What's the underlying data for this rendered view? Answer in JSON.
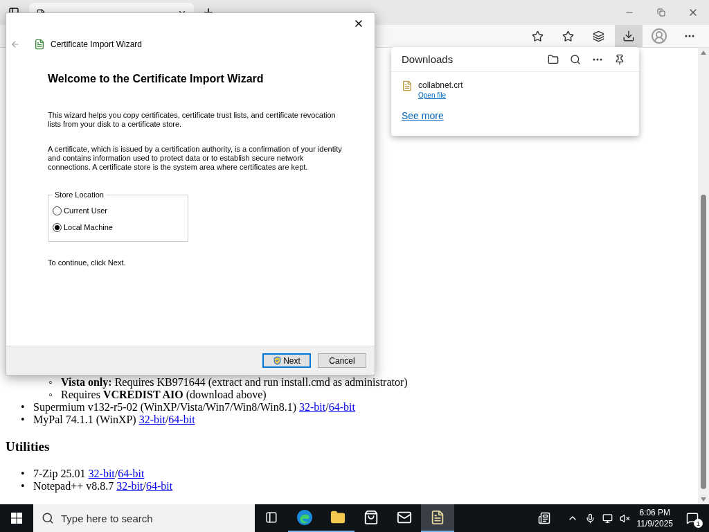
{
  "browser": {
    "tab": {
      "kind": "page"
    },
    "toolbar_buttons": [
      {
        "kind": "add-favorite",
        "selected": false
      },
      {
        "kind": "favorites",
        "selected": false
      },
      {
        "kind": "collections",
        "selected": false
      },
      {
        "kind": "downloads",
        "selected": true
      },
      {
        "kind": "profile",
        "selected": false
      },
      {
        "kind": "more",
        "selected": false
      }
    ]
  },
  "downloads_panel": {
    "title": "Downloads",
    "items": [
      {
        "file": "collabnet.crt",
        "action": "Open file"
      }
    ],
    "see_more": "See more"
  },
  "page": {
    "sections": [
      {
        "kind": "list",
        "items": [
          {
            "children": [
              {
                "marker": "◦",
                "text": "**Vista only:** Requires KB971644 (extract and run install.cmd as administrator)"
              },
              {
                "marker": "◦",
                "text": "Requires **VCREDIST AIO** (download above)"
              }
            ]
          },
          {
            "marker": "•",
            "text": "Supermium v132-r5-02 (WinXP/Vista/Win7/Win8/Win8.1)",
            "links": [
              "32-bit",
              "64-bit"
            ],
            "separator": "/"
          },
          {
            "marker": "•",
            "text": "MyPal 74.1.1 (WinXP)",
            "links": [
              "32-bit",
              "64-bit"
            ],
            "separator": "/"
          }
        ]
      },
      {
        "kind": "heading",
        "text": "Utilities"
      },
      {
        "kind": "list",
        "items": [
          {
            "marker": "•",
            "text": "7-Zip 25.01",
            "links": [
              "32-bit",
              "64-bit"
            ],
            "separator": "/"
          },
          {
            "marker": "•",
            "text": "Notepad++ v8.8.7",
            "links": [
              "32-bit",
              "64-bit"
            ],
            "separator": "/"
          }
        ]
      }
    ]
  },
  "dialog": {
    "title": "Certificate Import Wizard",
    "heading": "Welcome to the Certificate Import Wizard",
    "paragraphs": [
      "This wizard helps you copy certificates, certificate trust lists, and certificate revocation lists from your disk to a certificate store.",
      "A certificate, which is issued by a certification authority, is a confirmation of your identity and contains information used to protect data or to establish secure network connections. A certificate store is the system area where certificates are kept."
    ],
    "store_location": {
      "label": "Store Location",
      "options": [
        {
          "label": "Current User",
          "selected": false
        },
        {
          "label": "Local Machine",
          "selected": true
        }
      ]
    },
    "instruction": "To continue, click Next.",
    "buttons": [
      {
        "label": "Next",
        "focused": true,
        "kind": "shield"
      },
      {
        "label": "Cancel",
        "focused": false,
        "kind": "plain"
      }
    ]
  },
  "taskbar": {
    "search_placeholder": "Type here to search",
    "apps": [
      {
        "kind": "task-view",
        "running": false,
        "selected": false
      },
      {
        "kind": "edge",
        "running": true,
        "selected": false
      },
      {
        "kind": "explorer",
        "running": true,
        "selected": false
      },
      {
        "kind": "store",
        "running": false,
        "selected": false
      },
      {
        "kind": "mail",
        "running": false,
        "selected": false
      },
      {
        "kind": "certificate",
        "running": true,
        "selected": true
      }
    ],
    "time": "6:06 PM",
    "date": "11/9/2025",
    "notification_count": "1"
  }
}
